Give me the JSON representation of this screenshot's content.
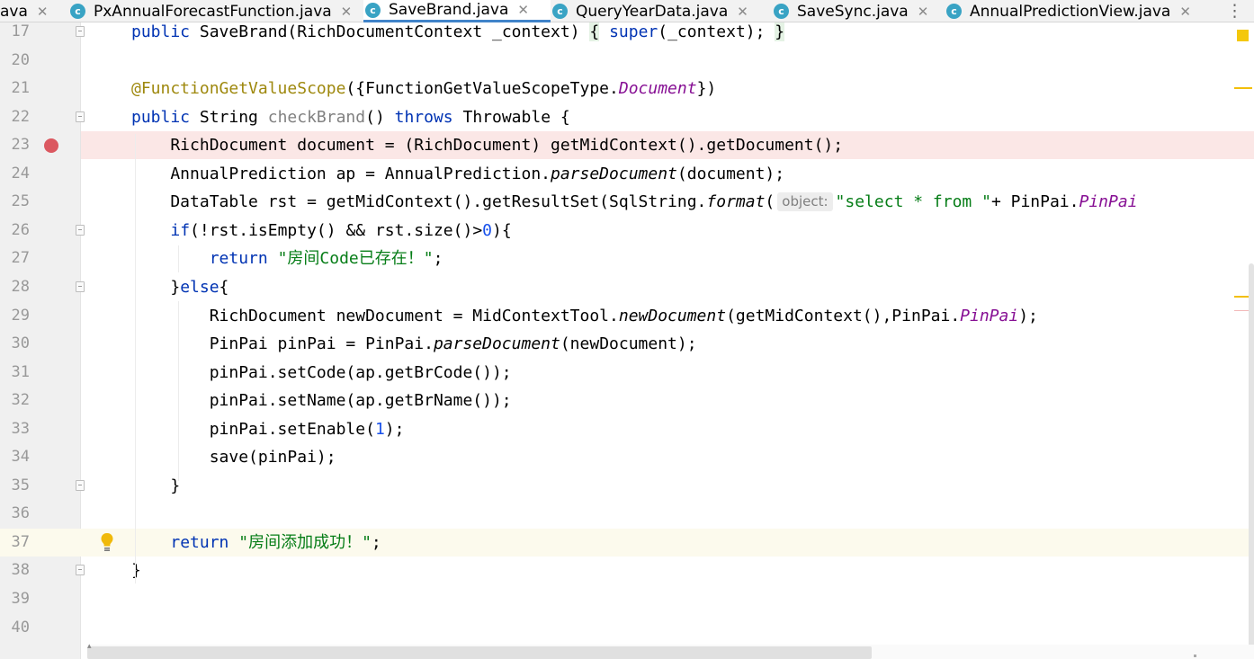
{
  "tabs": [
    {
      "name": "ava",
      "icon": "c",
      "close": "✕",
      "active": false
    },
    {
      "name": "PxAnnualForecastFunction.java",
      "icon": "c",
      "close": "✕",
      "active": false
    },
    {
      "name": "SaveBrand.java",
      "icon": "c",
      "close": "✕",
      "active": true
    },
    {
      "name": "QueryYearData.java",
      "icon": "c",
      "close": "✕",
      "active": false
    },
    {
      "name": "SaveSync.java",
      "icon": "c",
      "close": "✕",
      "active": false
    },
    {
      "name": "AnnualPredictionView.java",
      "icon": "c",
      "close": "✕",
      "active": false
    }
  ],
  "menu_icon": "⋮",
  "icons": {
    "class_icon": "class-c-icon",
    "breakpoint": "breakpoint-icon",
    "bulb": "intention-bulb-icon",
    "fold": "fold-marker-icon"
  },
  "colors": {
    "keyword": "#0033b3",
    "annotation": "#9e880d",
    "string": "#067d17",
    "number": "#1750eb",
    "field": "#871094",
    "breakpoint": "#db5860",
    "breakpoint_line": "#fbe7e6",
    "caret_line": "#fcfaed",
    "active_tab_underline": "#4083c9"
  },
  "lines": [
    {
      "num": "17",
      "fold": true,
      "tokens": [
        {
          "t": "public",
          "c": "kw"
        },
        {
          "t": " "
        },
        {
          "t": "SaveBrand"
        },
        {
          "t": "(RichDocumentContext _context) "
        },
        {
          "t": "{",
          "c": "brace-hl"
        },
        {
          "t": " "
        },
        {
          "t": "super",
          "c": "kw"
        },
        {
          "t": "(_context); "
        },
        {
          "t": "}",
          "c": "brace-hl"
        }
      ]
    },
    {
      "num": "20",
      "tokens": []
    },
    {
      "num": "21",
      "tokens": [
        {
          "t": "@FunctionGetValueScope",
          "c": "ann"
        },
        {
          "t": "({FunctionGetValueScopeType."
        },
        {
          "t": "Document",
          "c": "ital-purple"
        },
        {
          "t": "})"
        }
      ]
    },
    {
      "num": "22",
      "fold": true,
      "tokens": [
        {
          "t": "public",
          "c": "kw"
        },
        {
          "t": " String "
        },
        {
          "t": "checkBrand",
          "c": "unused"
        },
        {
          "t": "() "
        },
        {
          "t": "throws",
          "c": "kw"
        },
        {
          "t": " Throwable {"
        }
      ]
    },
    {
      "num": "23",
      "breakpoint": true,
      "tokens": [
        {
          "t": "    RichDocument document = (RichDocument) getMidContext().getDocument();"
        }
      ]
    },
    {
      "num": "24",
      "tokens": [
        {
          "t": "    AnnualPrediction ap = AnnualPrediction."
        },
        {
          "t": "parseDocument",
          "c": "ital"
        },
        {
          "t": "(document);"
        }
      ]
    },
    {
      "num": "25",
      "tokens": [
        {
          "t": "    DataTable rst = getMidContext().getResultSet(SqlString."
        },
        {
          "t": "format",
          "c": "ital"
        },
        {
          "t": "("
        },
        {
          "t": "object:",
          "c": "hint"
        },
        {
          "t": "\"select * from \"",
          "c": "str"
        },
        {
          "t": "+ PinPai."
        },
        {
          "t": "PinPai",
          "c": "ital-purple"
        }
      ]
    },
    {
      "num": "26",
      "fold": true,
      "tokens": [
        {
          "t": "    "
        },
        {
          "t": "if",
          "c": "kw"
        },
        {
          "t": "(!rst.isEmpty() && rst.size()>"
        },
        {
          "t": "0",
          "c": "num"
        },
        {
          "t": "){"
        }
      ]
    },
    {
      "num": "27",
      "tokens": [
        {
          "t": "        "
        },
        {
          "t": "return",
          "c": "kw"
        },
        {
          "t": " "
        },
        {
          "t": "\"房间Code已存在！\"",
          "c": "str"
        },
        {
          "t": ";"
        }
      ]
    },
    {
      "num": "28",
      "fold": true,
      "tokens": [
        {
          "t": "    }"
        },
        {
          "t": "else",
          "c": "kw"
        },
        {
          "t": "{"
        }
      ]
    },
    {
      "num": "29",
      "tokens": [
        {
          "t": "        RichDocument newDocument = MidContextTool."
        },
        {
          "t": "newDocument",
          "c": "ital"
        },
        {
          "t": "(getMidContext(),PinPai."
        },
        {
          "t": "PinPai",
          "c": "ital-purple"
        },
        {
          "t": ");"
        }
      ]
    },
    {
      "num": "30",
      "tokens": [
        {
          "t": "        PinPai pinPai = PinPai."
        },
        {
          "t": "parseDocument",
          "c": "ital"
        },
        {
          "t": "(newDocument);"
        }
      ]
    },
    {
      "num": "31",
      "tokens": [
        {
          "t": "        pinPai.setCode(ap.getBrCode());"
        }
      ]
    },
    {
      "num": "32",
      "tokens": [
        {
          "t": "        pinPai.setName(ap.getBrName());"
        }
      ]
    },
    {
      "num": "33",
      "tokens": [
        {
          "t": "        pinPai.setEnable("
        },
        {
          "t": "1",
          "c": "num"
        },
        {
          "t": ");"
        }
      ]
    },
    {
      "num": "34",
      "tokens": [
        {
          "t": "        save(pinPai);"
        }
      ]
    },
    {
      "num": "35",
      "fold": true,
      "tokens": [
        {
          "t": "    }"
        }
      ]
    },
    {
      "num": "36",
      "tokens": []
    },
    {
      "num": "37",
      "caret": true,
      "bulb": true,
      "tokens": [
        {
          "t": "    "
        },
        {
          "t": "return",
          "c": "kw"
        },
        {
          "t": " "
        },
        {
          "t": "\"房间添加成功！\"",
          "c": "str"
        },
        {
          "t": ";"
        }
      ]
    },
    {
      "num": "38",
      "fold": true,
      "tokens": [
        {
          "t": "}"
        }
      ]
    },
    {
      "num": "39",
      "tokens": []
    },
    {
      "num": "40",
      "tokens": []
    }
  ]
}
